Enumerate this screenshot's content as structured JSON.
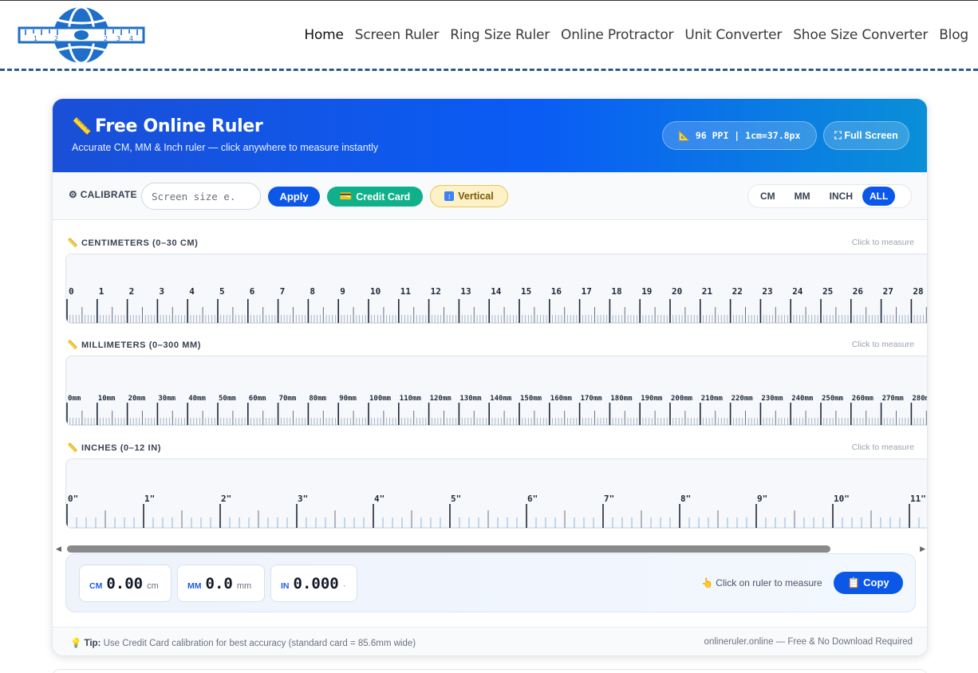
{
  "nav": {
    "items": [
      {
        "label": "Home",
        "active": true
      },
      {
        "label": "Screen Ruler"
      },
      {
        "label": "Ring Size Ruler"
      },
      {
        "label": "Online Protractor"
      },
      {
        "label": "Unit Converter"
      },
      {
        "label": "Shoe Size Converter"
      },
      {
        "label": "Blog"
      }
    ]
  },
  "logo": {
    "ticks": [
      "1",
      "2",
      "2",
      "3",
      "4"
    ]
  },
  "hero": {
    "icon": "📏",
    "title": "Free Online Ruler",
    "subtitle": "Accurate CM, MM & Inch ruler — click anywhere to measure instantly",
    "ppi_badge": "📐 96 PPI | 1cm=37.8px",
    "fullscreen_label": "⛶ Full Screen"
  },
  "controls": {
    "calibrate_label": "⚙ CALIBRATE",
    "screen_size_placeholder": "Screen size e.",
    "apply_label": "Apply",
    "credit_card_label": "Credit Card",
    "credit_card_icon": "💳",
    "vertical_label": "Vertical",
    "vertical_icon": "↕",
    "units": [
      "CM",
      "MM",
      "INCH",
      "ALL"
    ],
    "selected_unit": "ALL"
  },
  "rulers": {
    "cm": {
      "title": "📏 CENTIMETERS (0–30 CM)",
      "hint": "Click to measure",
      "labels": [
        "0",
        "1",
        "2",
        "3",
        "4",
        "5",
        "6",
        "7",
        "8",
        "9",
        "10",
        "11",
        "12",
        "13",
        "14",
        "15",
        "16",
        "17",
        "18",
        "19",
        "20",
        "21",
        "22",
        "23",
        "24",
        "25",
        "26",
        "27",
        "28"
      ]
    },
    "mm": {
      "title": "📏 MILLIMETERS (0–300 MM)",
      "hint": "Click to measure",
      "labels": [
        "0mm",
        "10mm",
        "20mm",
        "30mm",
        "40mm",
        "50mm",
        "60mm",
        "70mm",
        "80mm",
        "90mm",
        "100mm",
        "110mm",
        "120mm",
        "130mm",
        "140mm",
        "150mm",
        "160mm",
        "170mm",
        "180mm",
        "190mm",
        "200mm",
        "210mm",
        "220mm",
        "230mm",
        "240mm",
        "250mm",
        "260mm",
        "270mm",
        "280mm"
      ]
    },
    "inch": {
      "title": "📏 INCHES (0–12 IN)",
      "hint": "Click to measure",
      "labels": [
        "0\"",
        "1\"",
        "2\"",
        "3\"",
        "4\"",
        "5\"",
        "6\"",
        "7\"",
        "8\"",
        "9\"",
        "10\"",
        "11\""
      ]
    }
  },
  "measure": {
    "cm": {
      "unit": "CM",
      "value": "0.00",
      "suffix": "cm"
    },
    "mm": {
      "unit": "MM",
      "value": "0.0",
      "suffix": "mm"
    },
    "inch": {
      "unit": "IN",
      "value": "0.000",
      "suffix": "·"
    },
    "hint": "👆 Click on ruler to measure",
    "copy_label": "📋 Copy"
  },
  "footer": {
    "tip_label": "💡 Tip:",
    "tip_text": "Use Credit Card calibration for best accuracy (standard card = 85.6mm wide)",
    "brand": "onlineruler.online — Free & No Download Required"
  },
  "colors": {
    "accent": "#0b57e8",
    "hero_start": "#1a4fd6",
    "hero_end": "#0a8fd8",
    "card_green": "#10b08a"
  }
}
